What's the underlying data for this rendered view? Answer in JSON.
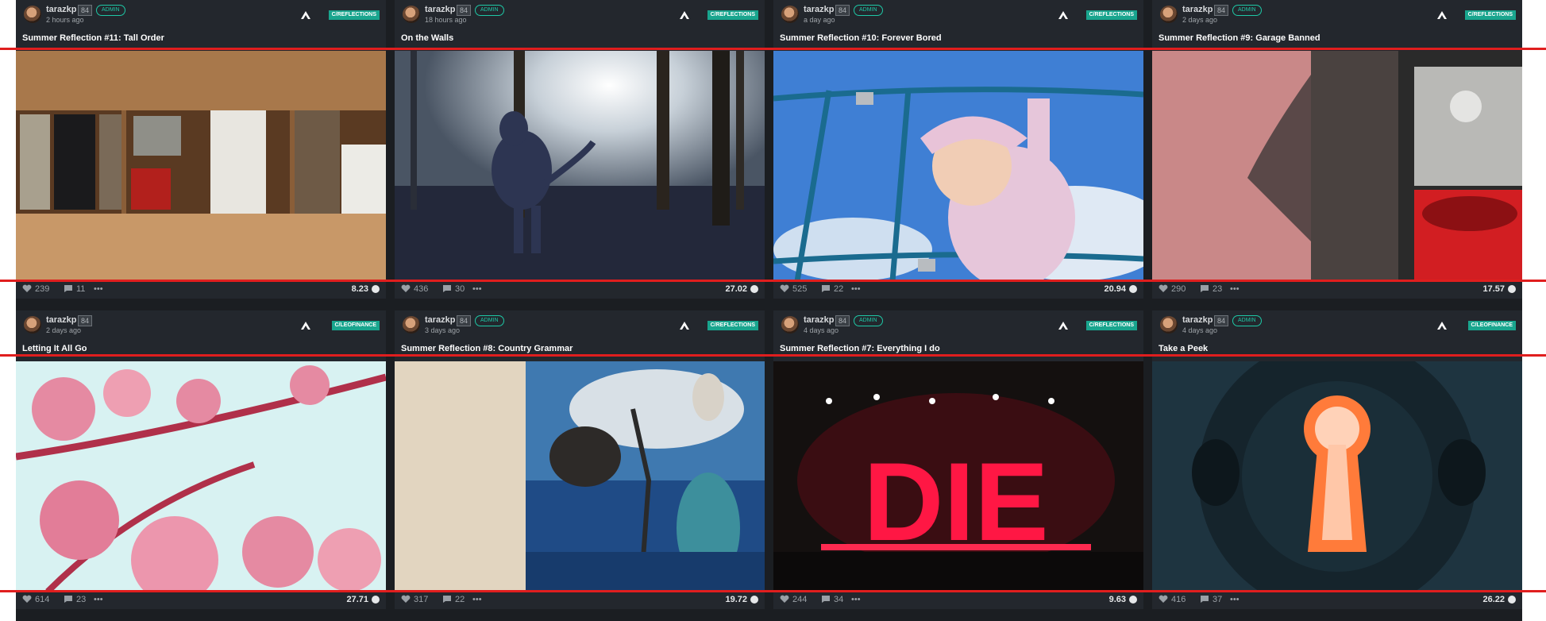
{
  "accent_color": "#19a58e",
  "cards": [
    {
      "user": "tarazkp",
      "rep": "84",
      "badge": "ADMIN",
      "time": "2 hours ago",
      "community": "C/REFLECTIONS",
      "title": "Summer Reflection #11: Tall Order",
      "likes": "239",
      "comments": "11",
      "more": "•••",
      "payout": "8.23",
      "image_icon": "drawer-photo"
    },
    {
      "user": "tarazkp",
      "rep": "84",
      "badge": "ADMIN",
      "time": "18 hours ago",
      "community": "C/REFLECTIONS",
      "title": "On the Walls",
      "likes": "436",
      "comments": "30",
      "more": "•••",
      "payout": "27.02",
      "image_icon": "dog-forest-photo"
    },
    {
      "user": "tarazkp",
      "rep": "84",
      "badge": "ADMIN",
      "time": "a day ago",
      "community": "C/REFLECTIONS",
      "title": "Summer Reflection #10: Forever Bored",
      "likes": "525",
      "comments": "22",
      "more": "•••",
      "payout": "20.94",
      "image_icon": "girl-rope-net-photo"
    },
    {
      "user": "tarazkp",
      "rep": "84",
      "badge": "ADMIN",
      "time": "2 days ago",
      "community": "C/REFLECTIONS",
      "title": "Summer Reflection #9: Garage Banned",
      "likes": "290",
      "comments": "23",
      "more": "•••",
      "payout": "17.57",
      "image_icon": "wall-shadow-photo"
    },
    {
      "user": "tarazkp",
      "rep": "84",
      "badge": "",
      "time": "2 days ago",
      "community": "C/LEOFINANCE",
      "title": "Letting It All Go",
      "likes": "614",
      "comments": "23",
      "more": "•••",
      "payout": "27.71",
      "image_icon": "cherry-blossom-photo"
    },
    {
      "user": "tarazkp",
      "rep": "84",
      "badge": "ADMIN",
      "time": "3 days ago",
      "community": "C/REFLECTIONS",
      "title": "Summer Reflection #8: Country Grammar",
      "likes": "317",
      "comments": "22",
      "more": "•••",
      "payout": "19.72",
      "image_icon": "abstract-tree-photo"
    },
    {
      "user": "tarazkp",
      "rep": "84",
      "badge": "ADMIN",
      "time": "4 days ago",
      "community": "C/REFLECTIONS",
      "title": "Summer Reflection #7: Everything I do",
      "likes": "244",
      "comments": "34",
      "more": "•••",
      "payout": "9.63",
      "image_icon": "concert-stage-photo",
      "image_text": "DIE"
    },
    {
      "user": "tarazkp",
      "rep": "84",
      "badge": "ADMIN",
      "time": "4 days ago",
      "community": "C/LEOFINANCE",
      "title": "Take a Peek",
      "likes": "416",
      "comments": "37",
      "more": "•••",
      "payout": "26.22",
      "image_icon": "keyhole-photo"
    }
  ]
}
